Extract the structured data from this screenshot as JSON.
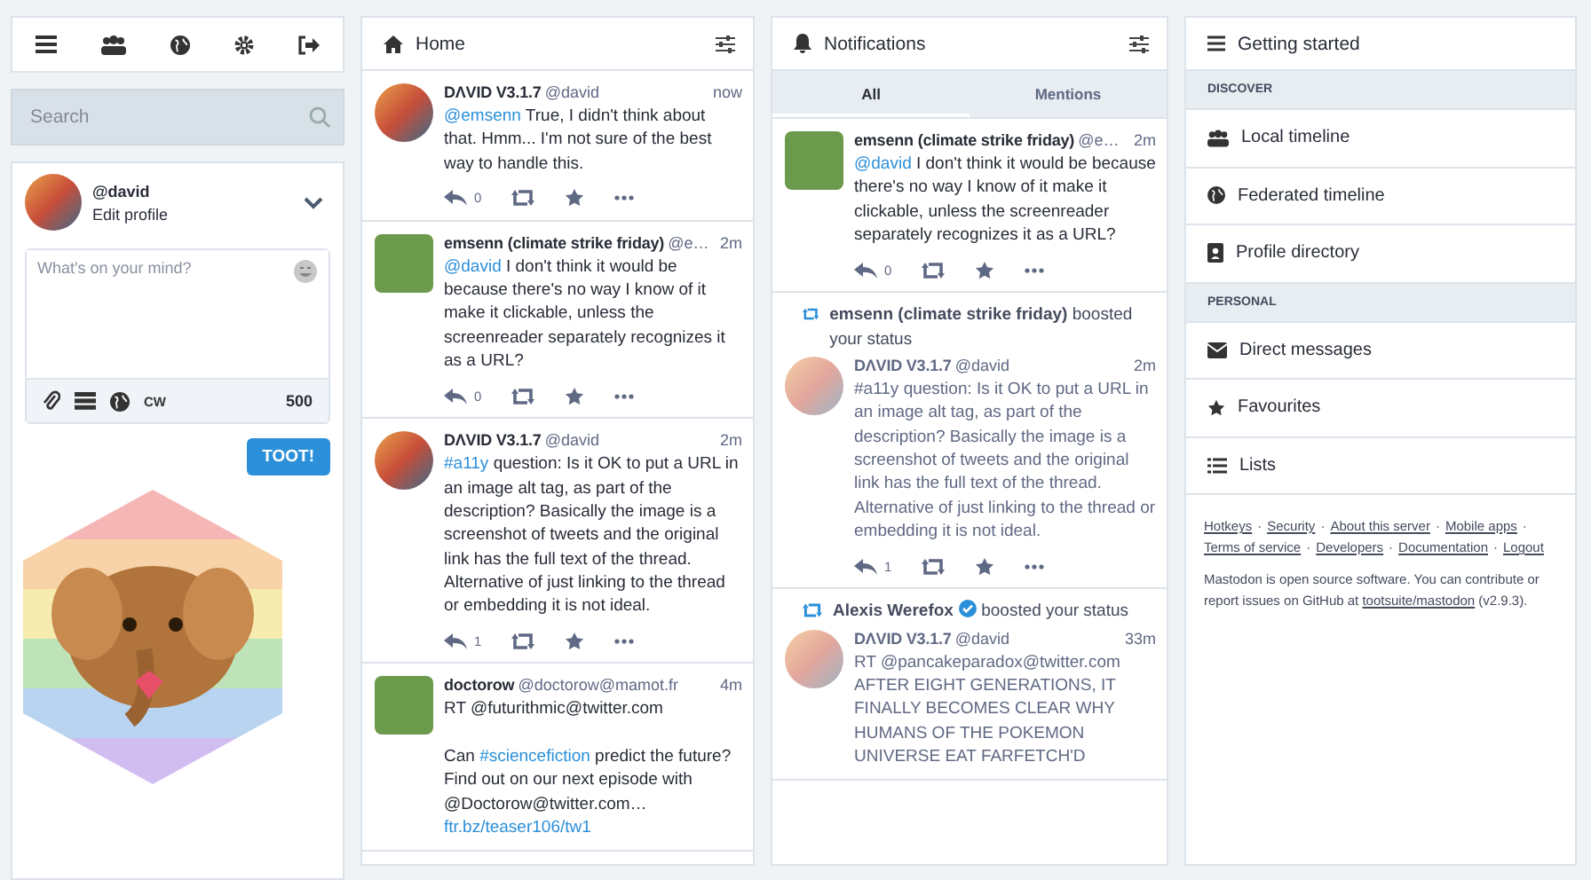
{
  "search": {
    "placeholder": "Search"
  },
  "profile": {
    "handle": "@david",
    "edit": "Edit profile"
  },
  "compose": {
    "placeholder": "What's on your mind?",
    "cw": "CW",
    "count": "500",
    "submit": "TOOT!"
  },
  "home": {
    "title": "Home",
    "statuses": [
      {
        "author": "DΛVID V3.1.7",
        "handle": "@david",
        "time": "now",
        "content": [
          {
            "kind": "link",
            "text": "@emsenn"
          },
          {
            "kind": "text",
            "text": " True, I didn't think about that. Hmm... I'm not sure of the best way to handle this."
          }
        ],
        "replies": "0"
      },
      {
        "author": "emsenn (climate strike friday)",
        "handle": "@e…",
        "time": "2m",
        "content": [
          {
            "kind": "link",
            "text": "@david"
          },
          {
            "kind": "text",
            "text": " I don't think it would be because there's no way I know of it make it clickable, unless the screenreader separately recognizes it as a URL?"
          }
        ],
        "replies": "0"
      },
      {
        "author": "DΛVID V3.1.7",
        "handle": "@david",
        "time": "2m",
        "content": [
          {
            "kind": "link",
            "text": "#a11y"
          },
          {
            "kind": "text",
            "text": " question: Is it OK to put a URL in an image alt tag, as part of the description? Basically the image is a screenshot of tweets and the original link has the full text of the thread. Alternative of just linking to the thread or embedding it is not ideal."
          }
        ],
        "replies": "1"
      },
      {
        "author": "doctorow",
        "handle": "@doctorow@mamot.fr",
        "time": "4m",
        "content": [
          {
            "kind": "text",
            "text": "RT @futurithmic@twitter.com"
          },
          {
            "kind": "break"
          },
          {
            "kind": "text",
            "text": "Can "
          },
          {
            "kind": "link",
            "text": "#sciencefiction"
          },
          {
            "kind": "text",
            "text": " predict the future? Find out on our next episode with @Doctorow@twitter.com… "
          },
          {
            "kind": "link",
            "text": "ftr.bz/teaser106/tw1"
          }
        ]
      }
    ]
  },
  "notifications": {
    "title": "Notifications",
    "tabs": [
      {
        "label": "All",
        "selected": true
      },
      {
        "label": "Mentions",
        "selected": false
      }
    ],
    "items": [
      {
        "kind": "mention",
        "status": {
          "author": "emsenn (climate strike friday)",
          "handle": "@e…",
          "time": "2m",
          "muted": false,
          "content": [
            {
              "kind": "link",
              "text": "@david"
            },
            {
              "kind": "text",
              "text": " I don't think it would be because there's no way I know of it make it clickable, unless the screenreader separately recognizes it as a URL?"
            }
          ],
          "replies": "0"
        }
      },
      {
        "kind": "boost",
        "who": "emsenn (climate strike friday)",
        "verified": false,
        "action": "boosted your status",
        "status": {
          "author": "DΛVID V3.1.7",
          "handle": "@david",
          "time": "2m",
          "muted": true,
          "content": [
            {
              "kind": "text",
              "text": "#a11y question: Is it OK to put a URL in an image alt tag, as part of the description? Basically the image is a screenshot of tweets and the original link has the full text of the thread. Alternative of just linking to the thread or embedding it is not ideal."
            }
          ],
          "replies": "1"
        }
      },
      {
        "kind": "boost",
        "who": "Alexis Werefox",
        "verified": true,
        "action": "boosted your status",
        "status": {
          "author": "DΛVID V3.1.7",
          "handle": "@david",
          "time": "33m",
          "muted": true,
          "content": [
            {
              "kind": "text",
              "text": "RT @pancakeparadox@twitter.com AFTER EIGHT GENERATIONS, IT FINALLY BECOMES CLEAR WHY HUMANS OF THE POKEMON UNIVERSE EAT FARFETCH'D"
            }
          ]
        }
      }
    ]
  },
  "getting_started": {
    "title": "Getting started",
    "sections": [
      {
        "heading": "DISCOVER",
        "items": [
          {
            "label": "Local timeline"
          },
          {
            "label": "Federated timeline"
          },
          {
            "label": "Profile directory"
          }
        ]
      },
      {
        "heading": "PERSONAL",
        "items": [
          {
            "label": "Direct messages"
          },
          {
            "label": "Favourites"
          },
          {
            "label": "Lists"
          }
        ]
      }
    ],
    "links": [
      {
        "label": "Hotkeys",
        "sep": "·"
      },
      {
        "label": "Security",
        "sep": "·"
      },
      {
        "label": "About this server",
        "sep": "·"
      },
      {
        "label": "Mobile apps",
        "sep": "·"
      },
      {
        "label": "Terms of service",
        "sep": "·"
      },
      {
        "label": "Developers",
        "sep": "·"
      },
      {
        "label": "Documentation",
        "sep": "·"
      },
      {
        "label": "Logout"
      }
    ],
    "about": "Mastodon is open source software. You can contribute or report issues on GitHub at",
    "repo": "tootsuite/mastodon",
    "version": "(v2.9.3)."
  }
}
